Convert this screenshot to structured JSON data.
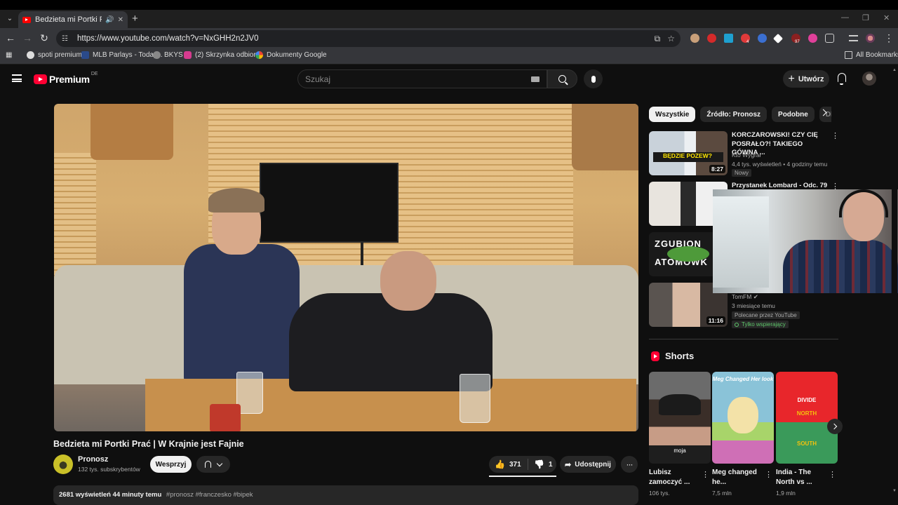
{
  "browser": {
    "tab_title": "Bedzieta mi Portki Prać | W",
    "url": "https://www.youtube.com/watch?v=NxGHH2n2JV0",
    "bookmarks": [
      "spoti premium",
      "MLB Parlays - Today...",
      "BKYS",
      "(2) Skrzynka odbior...",
      "Dokumenty Google"
    ],
    "all_bookmarks": "All Bookmarks",
    "extension_badges": [
      "4",
      "97"
    ]
  },
  "header": {
    "brand": "Premium",
    "region": "DE",
    "search_placeholder": "Szukaj",
    "create_label": "Utwórz"
  },
  "video": {
    "title": "Bedzieta mi Portki Prać | W Krajnie jest Fajnie",
    "channel": "Pronosz",
    "subscribers": "132 tys. subskrybentów",
    "support_label": "Wesprzyj",
    "likes": "371",
    "dislikes": "1",
    "share_label": "Udostępnij",
    "views_time": "2681 wyświetleń  44 minuty temu",
    "tags": "#pronosz #franczesko #bipek"
  },
  "chips": [
    "Wszystkie",
    "Źródło: Pronosz",
    "Podobne",
    "Dla"
  ],
  "recommendations": [
    {
      "title": "KORCZAROWSKI! CZY CIĘ POSRAŁO?! TAKIEGO GÓWNA ...",
      "channel": "Kto Wygrał",
      "meta": "4,4 tys. wyświetleń • 4 godziny temu",
      "badge": "Nowy",
      "duration": "8:27",
      "thumb_text": "BĘDZIE POZEW?"
    },
    {
      "title": "Przystanek Lombard - Odc. 79",
      "channel": "",
      "meta": "",
      "badge": "",
      "duration": "5",
      "thumb_text": ""
    },
    {
      "title": "",
      "channel": "",
      "meta": "",
      "badge": "",
      "duration": "",
      "thumb_text": "ZGUBION ATOMOWK"
    },
    {
      "title": "",
      "channel": "TomFM",
      "meta": "3 miesiące temu",
      "badge": "Polecane przez YouTube",
      "members": "Tylko wspierający",
      "duration": "11:16",
      "thumb_text": ""
    }
  ],
  "shorts": {
    "heading": "Shorts",
    "items": [
      {
        "title": "Lubisz zamoczyć ...",
        "views": "106 tys.",
        "overlay": "moja"
      },
      {
        "title": "Meg changed he...",
        "views": "7,5 mln",
        "overlay": "Meg Changed Her look"
      },
      {
        "title": "India - The North vs ...",
        "views": "1,9 mln",
        "overlay_top": "DIVIDE",
        "overlay_mid": "NORTH",
        "overlay_bot": "SOUTH"
      }
    ]
  },
  "colors": {
    "yt_red": "#ff0033",
    "background": "#0f0f0f",
    "chip_bg": "#272727",
    "members_green": "#5ec76b"
  }
}
